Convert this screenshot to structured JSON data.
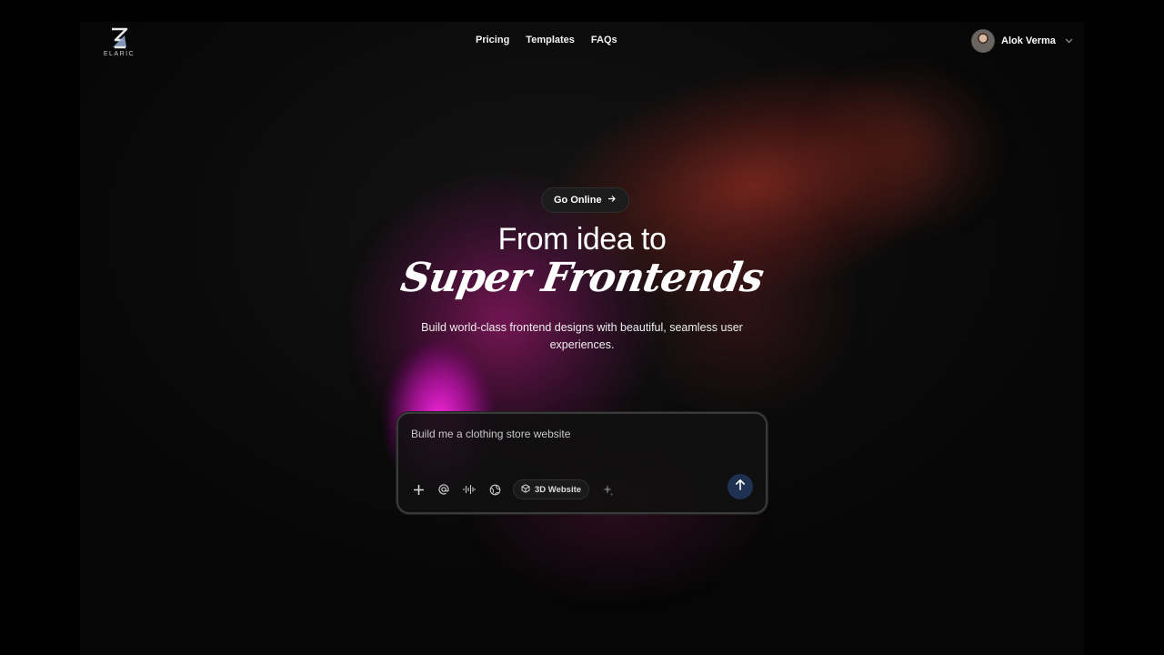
{
  "brand": {
    "logo_text": "ELARIC",
    "logo_icon": "elaric-logo-icon"
  },
  "nav": {
    "items": [
      {
        "label": "Pricing"
      },
      {
        "label": "Templates"
      },
      {
        "label": "FAQs"
      }
    ]
  },
  "user": {
    "name": "Alok Verma",
    "menu_icon": "chevron-down-icon"
  },
  "hero": {
    "badge_label": "Go Online",
    "badge_icon": "arrow-right-icon",
    "title_line1": "From idea to",
    "title_line2": "Super Frontends",
    "subtitle": "Build world-class frontend designs with beautiful, seamless user experiences."
  },
  "prompt": {
    "value": "Build me a clothing store website",
    "tools": [
      {
        "icon": "plus-icon"
      },
      {
        "icon": "at-icon"
      },
      {
        "icon": "waveform-icon"
      },
      {
        "icon": "globe-icon"
      }
    ],
    "chip_label": "3D Website",
    "chip_icon": "cube-icon",
    "sparkle_icon": "sparkle-icon",
    "send_icon": "arrow-up-icon"
  },
  "colors": {
    "send_button": "#1f3150",
    "glow_magenta": "#ff28e6",
    "glow_red": "#962d23"
  }
}
